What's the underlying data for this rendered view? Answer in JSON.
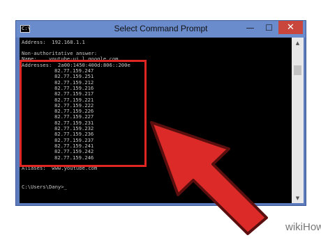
{
  "window": {
    "title": "Select Command Prompt",
    "app_icon_text": "C:\\",
    "minimize_label": "—",
    "maximize_label": "☐",
    "close_label": "✕"
  },
  "console": {
    "address_line": "Address:  192.168.1.1",
    "non_auth_line": "Non-authoritative answer:",
    "name_line": "Name:    youtube-ui.l.google.com",
    "addresses_line": "Addresses:  2a00:1450:400d:806::200e",
    "ip_addresses": [
      "82.77.159.247",
      "82.77.159.251",
      "82.77.159.212",
      "82.77.159.216",
      "82.77.159.217",
      "82.77.159.221",
      "82.77.159.222",
      "82.77.159.226",
      "82.77.159.227",
      "82.77.159.231",
      "82.77.159.232",
      "82.77.159.236",
      "82.77.159.237",
      "82.77.159.241",
      "82.77.159.242",
      "82.77.159.246"
    ],
    "aliases_line": "Aliases:  www.youtube.com",
    "prompt_line": "C:\\Users\\Dany>_"
  },
  "colors": {
    "highlight": "#e02623",
    "arrow_fill": "#db2a28",
    "arrow_outline": "#5a0f0e"
  },
  "watermark": {
    "text": "wikiHow"
  }
}
